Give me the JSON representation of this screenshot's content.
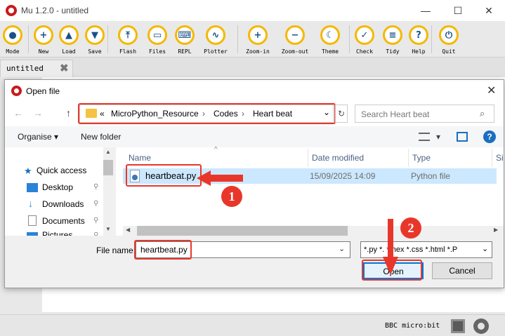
{
  "window": {
    "title": "Mu 1.2.0 - untitled",
    "minimize": "—",
    "maximize": "☐",
    "close": "✕"
  },
  "toolbar": [
    {
      "label": "Mode",
      "glyph": "●"
    },
    {
      "label": "New",
      "glyph": "+"
    },
    {
      "label": "Load",
      "glyph": "▲"
    },
    {
      "label": "Save",
      "glyph": "▼"
    },
    {
      "label": "Flash",
      "glyph": "⤒"
    },
    {
      "label": "Files",
      "glyph": "▭"
    },
    {
      "label": "REPL",
      "glyph": "⌨"
    },
    {
      "label": "Plotter",
      "glyph": "∿"
    },
    {
      "label": "Zoom-in",
      "glyph": "+"
    },
    {
      "label": "Zoom-out",
      "glyph": "−"
    },
    {
      "label": "Theme",
      "glyph": "☾"
    },
    {
      "label": "Check",
      "glyph": "✓"
    },
    {
      "label": "Tidy",
      "glyph": "≡"
    },
    {
      "label": "Help",
      "glyph": "?"
    },
    {
      "label": "Quit",
      "glyph": "⏻"
    }
  ],
  "tab": {
    "name": "untitled",
    "close": "✖"
  },
  "status": {
    "mode": "BBC micro:bit"
  },
  "dialog": {
    "title": "Open file",
    "close": "✕",
    "nav": {
      "back": "←",
      "forward": "→",
      "up": "↑"
    },
    "address": {
      "prefix": "«",
      "sep": "›",
      "crumbs": [
        "MicroPython_Resource",
        "Codes",
        "Heart beat"
      ],
      "dropdown": "⌄",
      "refresh": "↻"
    },
    "search": {
      "placeholder": "Search Heart beat",
      "icon": "⌕"
    },
    "commands": {
      "organise": "Organise ▾",
      "new_folder": "New folder",
      "view_dd": "▾"
    },
    "nav_pane": [
      {
        "label": "Quick access",
        "icon": "star-icon",
        "color": "#1a6fc0"
      },
      {
        "label": "Desktop",
        "icon": "desktop-icon",
        "color": "#2b82d9"
      },
      {
        "label": "Downloads",
        "icon": "download-icon",
        "color": "#2b82d9"
      },
      {
        "label": "Documents",
        "icon": "document-icon",
        "color": "#8a8a8a"
      },
      {
        "label": "Pictures",
        "icon": "pictures-icon",
        "color": "#2b82d9"
      }
    ],
    "pin": "📌",
    "columns": [
      "Name",
      "Date modified",
      "Type",
      "Si"
    ],
    "files": [
      {
        "name": "heartbeat.py",
        "date": "15/09/2025 14:09",
        "type": "Python file"
      }
    ],
    "file_name_label": "File name:",
    "file_name_value": "heartbeat.py",
    "filter_value": "*.py *.      *.hex *.css *.html *.P",
    "open_label": "Open",
    "cancel_label": "Cancel"
  },
  "callouts": [
    "1",
    "2"
  ],
  "accent": {
    "highlight": "#e8372a",
    "mu_yellow": "#f5b800",
    "mu_blue": "#1d4f87",
    "selection": "#cce8ff"
  }
}
